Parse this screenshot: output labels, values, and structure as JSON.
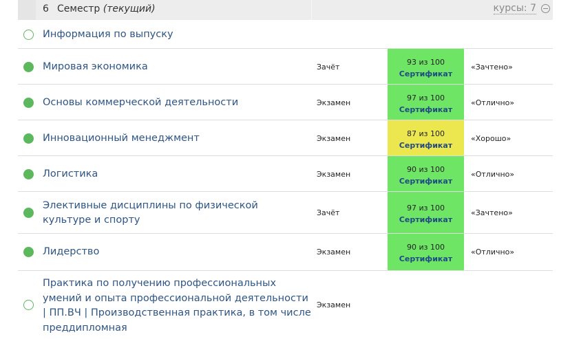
{
  "semester": {
    "number": "6",
    "title": "Семестр",
    "current": "(текущий)",
    "courses_link": "курсы: 7",
    "collapse_icon": "minus-circle-icon"
  },
  "rows": [
    {
      "name": "Информация по выпуску",
      "status": "empty",
      "type": "",
      "score": "",
      "cert": "",
      "grade": ""
    },
    {
      "name": "Мировая экономика",
      "status": "filled",
      "type": "Зачёт",
      "score": "93 из 100",
      "cert": "Сертификат",
      "grade": "«Зачтено»",
      "color": "#6fe565"
    },
    {
      "name": "Основы коммерческой деятельности",
      "status": "filled",
      "type": "Экзамен",
      "score": "97 из 100",
      "cert": "Сертификат",
      "grade": "«Отлично»",
      "color": "#6fe565"
    },
    {
      "name": "Инновационный менеджмент",
      "status": "filled",
      "type": "Экзамен",
      "score": "87 из 100",
      "cert": "Сертификат",
      "grade": "«Хорошо»",
      "color": "#ede74f"
    },
    {
      "name": "Логистика",
      "status": "filled",
      "type": "Экзамен",
      "score": "90 из 100",
      "cert": "Сертификат",
      "grade": "«Отлично»",
      "color": "#6fe565"
    },
    {
      "name": "Элективные дисциплины по физической культуре и спорту",
      "status": "filled",
      "type": "Зачёт",
      "score": "97 из 100",
      "cert": "Сертификат",
      "grade": "«Зачтено»",
      "color": "#6fe565"
    },
    {
      "name": "Лидерство",
      "status": "filled",
      "type": "Экзамен",
      "score": "90 из 100",
      "cert": "Сертификат",
      "grade": "«Отлично»",
      "color": "#6fe565"
    },
    {
      "name": "Практика по получению профессиональных умений и опыта профессиональной деятельности | ПП.ВЧ | Производственная практика, в том числе преддипломная",
      "status": "empty",
      "type": "Экзамен",
      "score": "",
      "cert": "",
      "grade": ""
    }
  ]
}
